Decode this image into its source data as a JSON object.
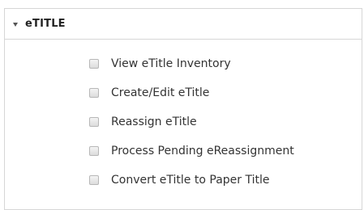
{
  "panel": {
    "title": "eTITLE",
    "expanded": true,
    "caret_icon": "caret-down-icon",
    "options": [
      {
        "label": "View eTitle Inventory",
        "checked": false
      },
      {
        "label": "Create/Edit eTitle",
        "checked": false
      },
      {
        "label": "Reassign eTitle",
        "checked": false
      },
      {
        "label": "Process Pending eReassignment",
        "checked": false
      },
      {
        "label": "Convert eTitle to Paper Title",
        "checked": false
      }
    ]
  }
}
